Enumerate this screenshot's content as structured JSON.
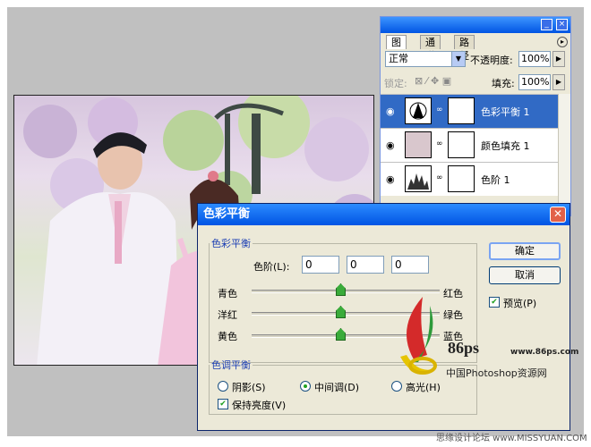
{
  "layers_panel": {
    "tabs": [
      "图层",
      "通道",
      "路径"
    ],
    "blend_mode": "正常",
    "opacity_label": "不透明度:",
    "opacity_value": "100%",
    "lock_label": "锁定:",
    "fill_label": "填充:",
    "fill_value": "100%",
    "layers": [
      {
        "name": "色彩平衡 1",
        "selected": true
      },
      {
        "name": "颜色填充 1",
        "selected": false
      },
      {
        "name": "色阶 1",
        "selected": false
      }
    ]
  },
  "dialog": {
    "title": "色彩平衡",
    "balance_group": "色彩平衡",
    "levels_label": "色阶(L):",
    "levels_values": [
      "0",
      "0",
      "0"
    ],
    "sliders": [
      {
        "left": "青色",
        "right": "红色",
        "value": 0
      },
      {
        "left": "洋红",
        "right": "绿色",
        "value": 0
      },
      {
        "left": "黄色",
        "right": "蓝色",
        "value": 0
      }
    ],
    "tone_group": "色调平衡",
    "tones": [
      {
        "label": "阴影(S)",
        "selected": false
      },
      {
        "label": "中间调(D)",
        "selected": true
      },
      {
        "label": "高光(H)",
        "selected": false
      }
    ],
    "preserve_label": "保持亮度(V)",
    "preserve_checked": true,
    "ok_label": "确定",
    "cancel_label": "取消",
    "preview_label": "预览(P)",
    "preview_checked": true
  },
  "watermark": {
    "logo_number": "86ps",
    "url": "www.86ps.com",
    "caption": "中国Photoshop资源网"
  },
  "footer": "思缘设计论坛 www.MISSYUAN.COM"
}
